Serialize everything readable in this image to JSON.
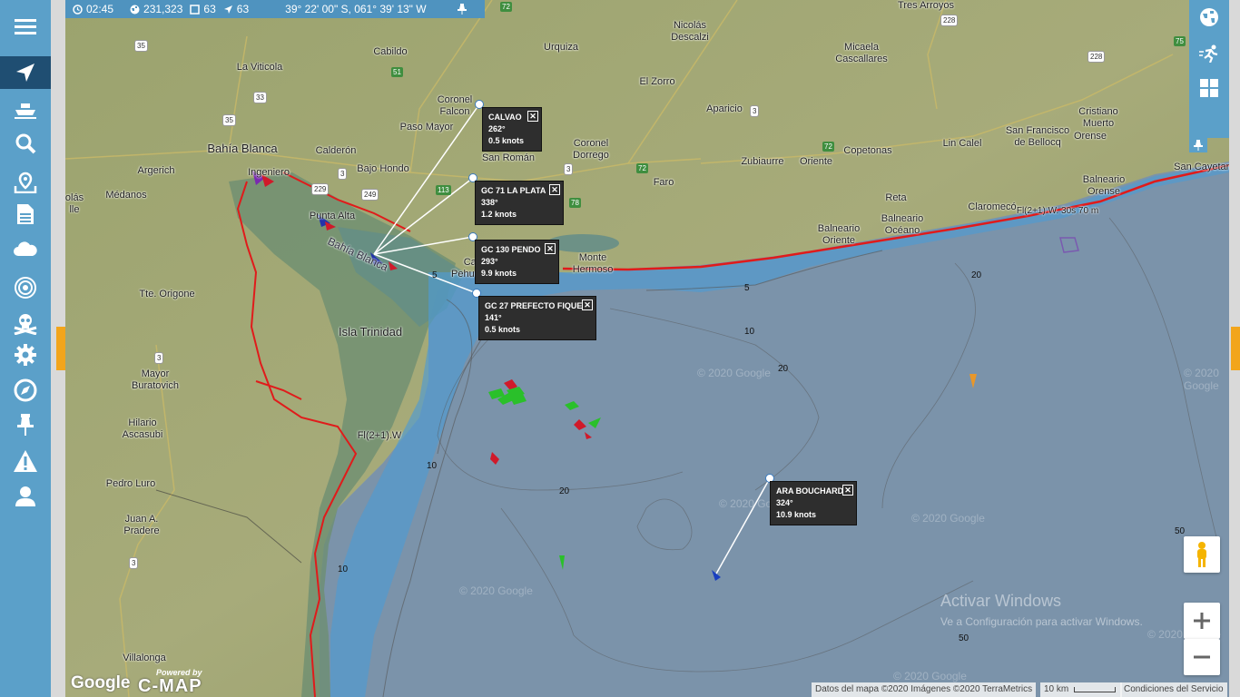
{
  "status": {
    "time": "02:45",
    "vessels_total": "231,323",
    "vessels_view": "63",
    "moving": "63",
    "coords": "39° 22' 00\" S, 061° 39' 13\" W"
  },
  "sidebar": {
    "items": [
      {
        "icon": "menu-icon"
      },
      {
        "icon": "navigation-arrow-icon"
      },
      {
        "icon": "ship-icon"
      },
      {
        "icon": "search-icon"
      },
      {
        "icon": "map-pin-icon"
      },
      {
        "icon": "document-icon"
      },
      {
        "icon": "cloud-icon"
      },
      {
        "icon": "target-icon"
      },
      {
        "icon": "skull-icon"
      },
      {
        "icon": "gear-icon"
      },
      {
        "icon": "compass-icon"
      },
      {
        "icon": "pin-icon"
      },
      {
        "icon": "warning-icon"
      },
      {
        "icon": "user-icon"
      }
    ]
  },
  "right_panel": {
    "items": [
      {
        "icon": "globe-icon"
      },
      {
        "icon": "runner-icon"
      },
      {
        "icon": "grid-icon"
      }
    ]
  },
  "places": {
    "tres_arroyos": "Tres Arroyos",
    "nicolas_descalzi": "Nicolás\nDescalzi",
    "urquiza": "Urquiza",
    "cabildo": "Cabildo",
    "la_viticola": "La Viticola",
    "micaela_cascallares": "Micaela\nCascallares",
    "el_zorro": "El Zorro",
    "coronel_falcon": "Coronel\nFalcon",
    "paso_mayor": "Paso Mayor",
    "aparicio": "Aparicio",
    "cristiano_muerto": "Cristiano\nMuerto",
    "bahia_blanca": "Bahía Blanca",
    "calderon": "Calderón",
    "san_roman": "San Román",
    "coronel_dorrego": "Coronel\nDorrego",
    "lin_calel": "Lin Calel",
    "san_francisco": "San Francisco\nde Bellocq",
    "orense": "Orense",
    "copetonas": "Copetonas",
    "argerich": "Argerich",
    "bajo_hondo": "Bajo Hondo",
    "zubiaurre": "Zubiaurre",
    "oriente": "Oriente",
    "faro": "Faro",
    "medanos": "Médanos",
    "ingeniero": "Ingeniero",
    "balneario_orense": "Balneario\nOrense",
    "san_cayetano": "San Cayetano",
    "olas": "olás\nlle",
    "reta": "Reta",
    "claromeco": "Claromecó",
    "punta_alta": "Punta Alta",
    "balneario_oriente": "Balneario\nOriente",
    "balneario_oceano": "Balneario\nOcéano",
    "monte_hermoso": "Monte\nHermoso",
    "pehuen": "Pehuen",
    "bahia_blanca_water": "Bahía Blanca",
    "tte_origone": "Tte. Origone",
    "isla_trinidad": "Isla Trinidad",
    "mayor_buratovich": "Mayor\nBuratovich",
    "hilario_ascasubi": "Hilario\nAscasubi",
    "pedro_luro": "Pedro Luro",
    "juan_pradere": "Juan A.\nPradere",
    "villalonga": "Villalonga",
    "light_fl": "Fl(2+1).W",
    "light_fl2": "Fl(2+1).W. 30s 70 m",
    "cal": "Cal"
  },
  "roads": [
    "72",
    "35",
    "228",
    "75",
    "51",
    "33",
    "35",
    "228",
    "72",
    "3",
    "249",
    "229",
    "113",
    "3",
    "78",
    "72",
    "3",
    "3",
    "3"
  ],
  "depth_labels": [
    "5",
    "10",
    "20",
    "20",
    "10",
    "20",
    "50",
    "50",
    "10",
    "5"
  ],
  "callouts": [
    {
      "name": "CALVAO",
      "course": "262°",
      "speed": "0.5 knots"
    },
    {
      "name": "GC 71 LA PLATA",
      "course": "338°",
      "speed": "1.2 knots"
    },
    {
      "name": "GC 130 PENDO",
      "course": "293°",
      "speed": "9.9 knots"
    },
    {
      "name": "GC 27 PREFECTO FIQUE",
      "course": "141°",
      "speed": "0.5 knots"
    },
    {
      "name": "ARA BOUCHARD",
      "course": "324°",
      "speed": "10.9 knots"
    }
  ],
  "close_symbol": "✕",
  "watermarks": [
    "© 2020 Google",
    "© 2020 Google",
    "© 2020 Google",
    "© 2020 Google",
    "© 2020 Google",
    "© 2020 Google",
    "© 2020 Google"
  ],
  "activate": {
    "title": "Activar Windows",
    "sub": "Ve a Configuración para activar Windows."
  },
  "footer": {
    "google": "Google",
    "powered_by": "Powered by",
    "cmap": "C-MAP",
    "attribution": "Datos del mapa ©2020 Imágenes ©2020 TerraMetrics",
    "scale": "10 km",
    "terms": "Condiciones del Servicio"
  },
  "colors": {
    "accent": "#5ba0c9",
    "active": "#1f4e72",
    "handle": "#f2a51c",
    "track": "#e01b1b"
  }
}
